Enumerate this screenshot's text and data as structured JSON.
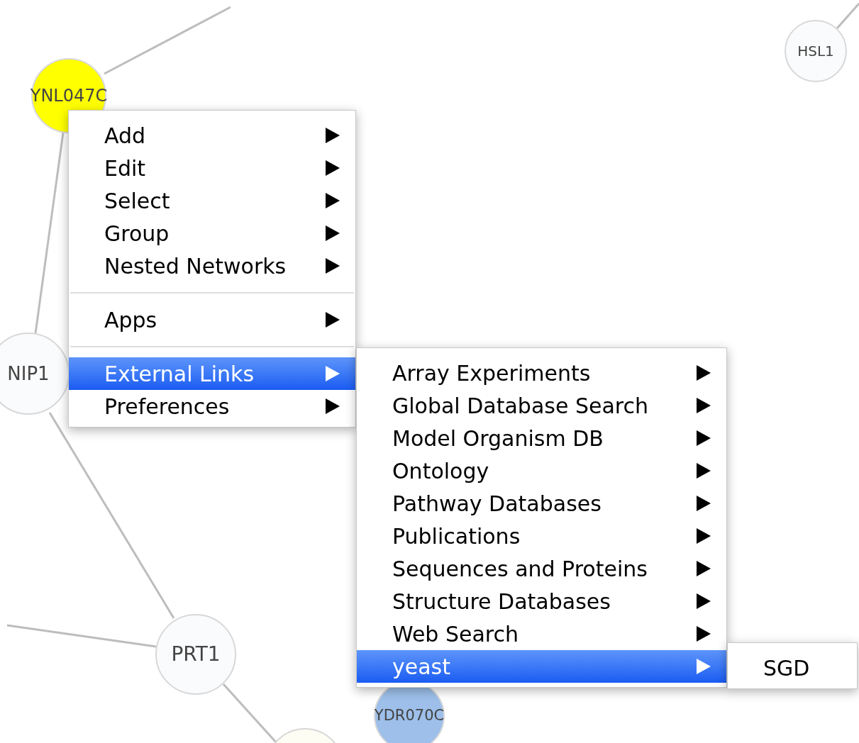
{
  "nodes": [
    {
      "label": "YNL047C",
      "color": "#ffff00"
    },
    {
      "label": "NIP1",
      "color": "#fafbfc"
    },
    {
      "label": "HSL1",
      "color": "#fafbfc"
    },
    {
      "label": "PRT1",
      "color": "#fafbfc"
    },
    {
      "label": "YDR070C",
      "color": "#9dbfea"
    },
    {
      "color": "#fdfdf3"
    }
  ],
  "menus": [
    {
      "groups": [
        [
          {
            "label": "Add",
            "has_submenu": true,
            "selected": false
          },
          {
            "label": "Edit",
            "has_submenu": true,
            "selected": false
          },
          {
            "label": "Select",
            "has_submenu": true,
            "selected": false
          },
          {
            "label": "Group",
            "has_submenu": true,
            "selected": false
          },
          {
            "label": "Nested Networks",
            "has_submenu": true,
            "selected": false
          }
        ],
        [
          {
            "label": "Apps",
            "has_submenu": true,
            "selected": false
          }
        ],
        [
          {
            "label": "External Links",
            "has_submenu": true,
            "selected": true
          },
          {
            "label": "Preferences",
            "has_submenu": true,
            "selected": false
          }
        ]
      ]
    },
    {
      "groups": [
        [
          {
            "label": "Array Experiments",
            "has_submenu": true,
            "selected": false
          },
          {
            "label": "Global Database Search",
            "has_submenu": true,
            "selected": false
          },
          {
            "label": "Model Organism DB",
            "has_submenu": true,
            "selected": false
          },
          {
            "label": "Ontology",
            "has_submenu": true,
            "selected": false
          },
          {
            "label": "Pathway Databases",
            "has_submenu": true,
            "selected": false
          },
          {
            "label": "Publications",
            "has_submenu": true,
            "selected": false
          },
          {
            "label": "Sequences and Proteins",
            "has_submenu": true,
            "selected": false
          },
          {
            "label": "Structure Databases",
            "has_submenu": true,
            "selected": false
          },
          {
            "label": "Web Search",
            "has_submenu": true,
            "selected": false
          },
          {
            "label": "yeast",
            "has_submenu": true,
            "selected": true
          }
        ]
      ]
    },
    {
      "groups": [
        [
          {
            "label": "SGD",
            "has_submenu": false,
            "selected": false
          }
        ]
      ]
    }
  ]
}
